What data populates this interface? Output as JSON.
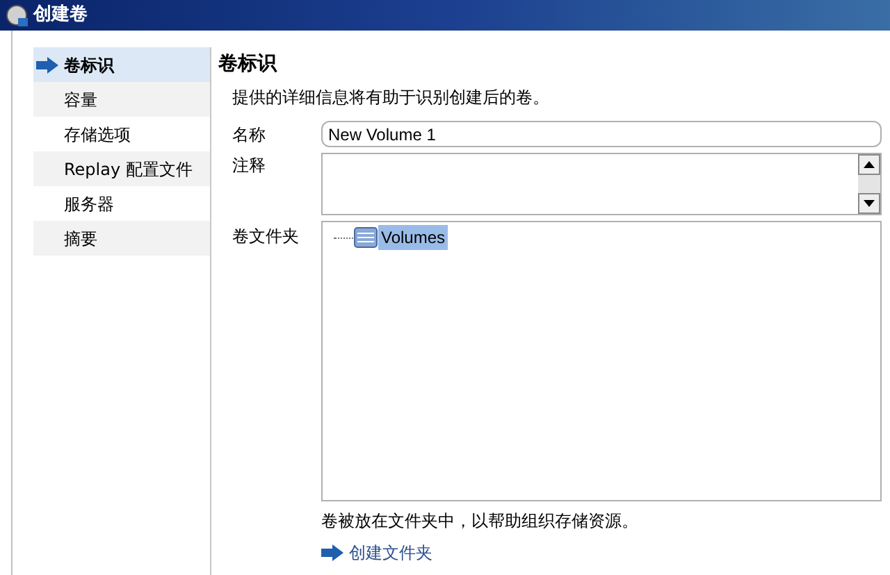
{
  "window": {
    "title": "创建卷"
  },
  "sidebar": {
    "items": [
      {
        "label": "卷标识",
        "selected": true
      },
      {
        "label": "容量",
        "selected": false
      },
      {
        "label": "存储选项",
        "selected": false
      },
      {
        "label": "Replay 配置文件",
        "selected": false
      },
      {
        "label": "服务器",
        "selected": false
      },
      {
        "label": "摘要",
        "selected": false
      }
    ]
  },
  "content": {
    "heading": "卷标识",
    "description": "提供的详细信息将有助于识别创建后的卷。",
    "name_label": "名称",
    "name_value": "New Volume 1",
    "notes_label": "注释",
    "folder_label": "卷文件夹",
    "folder_tree": [
      {
        "label": "Volumes",
        "selected": true
      }
    ],
    "caption": "卷被放在文件夹中，以帮助组织存储资源。",
    "link": "创建文件夹"
  }
}
